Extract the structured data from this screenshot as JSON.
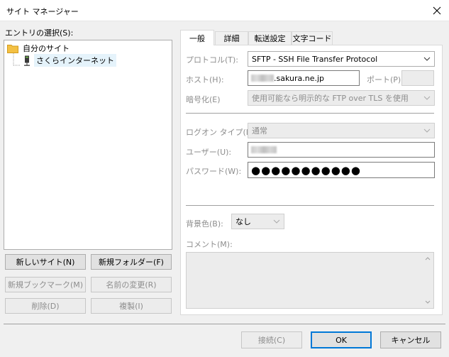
{
  "window": {
    "title": "サイト マネージャー"
  },
  "left": {
    "entry_label": "エントリの選択(S):",
    "tree": [
      {
        "label": "自分のサイト",
        "icon": "folder-icon"
      },
      {
        "label": "さくらインターネット",
        "icon": "server-icon"
      }
    ],
    "buttons": {
      "new_site": "新しいサイト(N)",
      "new_folder": "新規フォルダー(F)",
      "new_bookmark": "新規ブックマーク(M)",
      "rename": "名前の変更(R)",
      "delete": "削除(D)",
      "duplicate": "複製(I)"
    }
  },
  "tabs": [
    "一般",
    "詳細",
    "転送設定",
    "文字コード"
  ],
  "general": {
    "protocol_label": "プロトコル(T):",
    "protocol_value": "SFTP - SSH File Transfer Protocol",
    "host_label": "ホスト(H):",
    "host_value": ".sakura.ne.jp",
    "port_label": "ポート(P):",
    "port_value": "",
    "encryption_label": "暗号化(E)",
    "encryption_value": "使用可能なら明示的な FTP over TLS を使用",
    "logon_type_label": "ログオン タイプ(L):",
    "logon_type_value": "通常",
    "user_label": "ユーザー(U):",
    "password_label": "パスワード(W):",
    "password_value": "●●●●●●●●●●●",
    "bgcolor_label": "背景色(B):",
    "bgcolor_value": "なし",
    "comment_label": "コメント(M):"
  },
  "footer": {
    "connect": "接続(C)",
    "ok": "OK",
    "cancel": "キャンセル"
  }
}
